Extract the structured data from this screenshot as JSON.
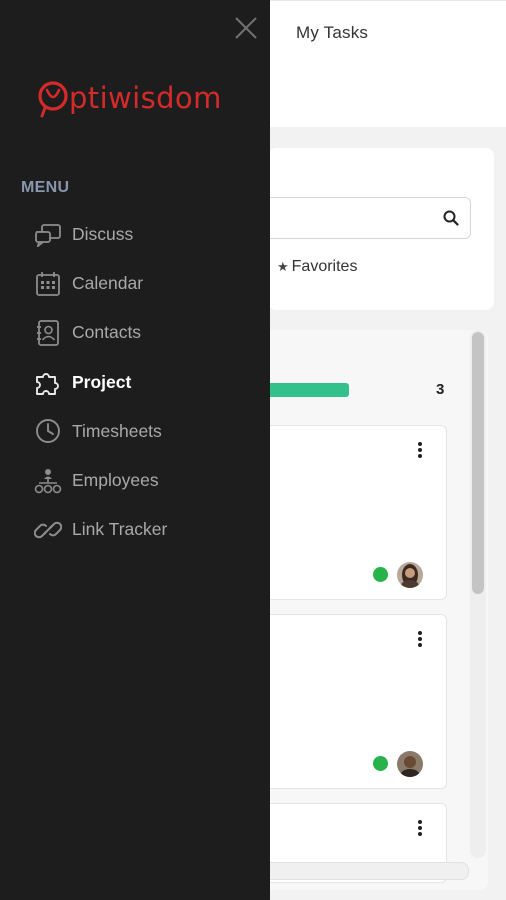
{
  "header": {
    "title": "My Tasks"
  },
  "filters": {
    "search_placeholder": "",
    "favorites_label": "Favorites"
  },
  "board": {
    "column_count": "3",
    "progress_fraction": 0.4
  },
  "drawer": {
    "brand": {
      "mark": "O",
      "rest": "ptiwisdom",
      "color": "#d42a2a"
    },
    "menu_label": "MENU",
    "items": [
      {
        "label": "Discuss",
        "icon": "chat-bubbles-icon"
      },
      {
        "label": "Calendar",
        "icon": "calendar-icon"
      },
      {
        "label": "Contacts",
        "icon": "contact-book-icon"
      },
      {
        "label": "Project",
        "icon": "puzzle-icon",
        "active": true
      },
      {
        "label": "Timesheets",
        "icon": "clock-icon"
      },
      {
        "label": "Employees",
        "icon": "org-chart-icon"
      },
      {
        "label": "Link Tracker",
        "icon": "link-icon"
      }
    ]
  },
  "colors": {
    "drawer_bg": "#1d1d1e",
    "accent_green": "#34c08a",
    "status_online": "#27b24a",
    "brand_red": "#d42a2a"
  }
}
